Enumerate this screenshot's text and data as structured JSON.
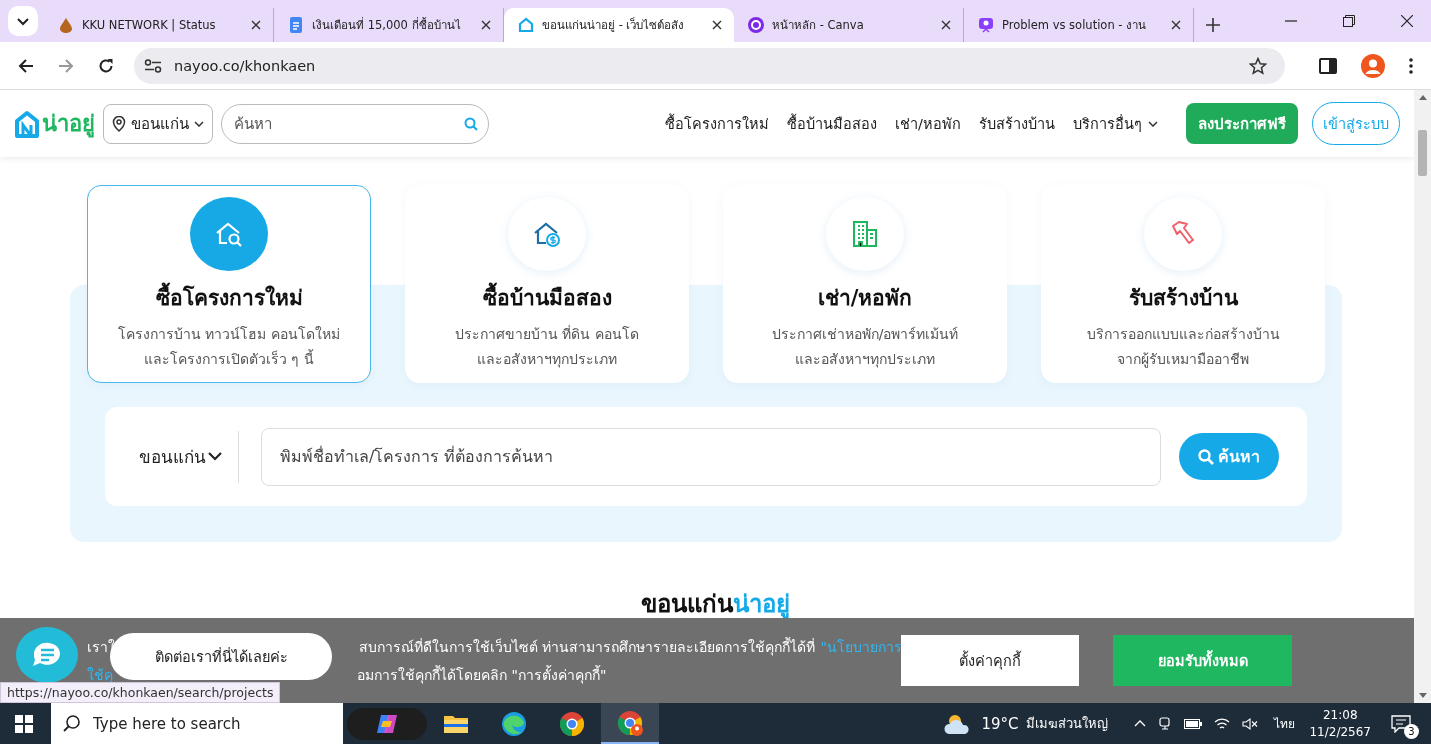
{
  "browser": {
    "tabs": [
      {
        "title": "KKU NETWORK | Status",
        "selected": false
      },
      {
        "title": "เงินเดือนที่ 15,000 กี่ซื้อบ้านไ",
        "selected": false
      },
      {
        "title": "ขอนแก่นน่าอยู่ - เว็บไซต์อสัง",
        "selected": true
      },
      {
        "title": "หน้าหลัก - Canva",
        "selected": false
      },
      {
        "title": "Problem vs solution - งาน",
        "selected": false
      }
    ],
    "address": "nayoo.co/khonkaen"
  },
  "site": {
    "logo": "น่าอยู่",
    "location": "ขอนแก่น",
    "search_placeholder": "ค้นหา",
    "nav": [
      {
        "label": "ซื้อโครงการใหม่",
        "dropdown": false
      },
      {
        "label": "ซื้อบ้านมือสอง",
        "dropdown": false
      },
      {
        "label": "เช่า/หอพัก",
        "dropdown": false
      },
      {
        "label": "รับสร้างบ้าน",
        "dropdown": false
      },
      {
        "label": "บริการอื่นๆ",
        "dropdown": true
      }
    ],
    "post_button": "ลงประกาศฟรี",
    "login_button": "เข้าสู่ระบบ"
  },
  "categories": [
    {
      "title": "ซื้อโครงการใหม่",
      "lines": [
        "โครงการบ้าน ทาวน์โฮม คอนโดใหม่",
        "และโครงการเปิดตัวเร็ว ๆ นี้"
      ],
      "selected": true
    },
    {
      "title": "ซื้อบ้านมือสอง",
      "lines": [
        "ประกาศขายบ้าน ที่ดิน คอนโด",
        "และอสังหาฯทุกประเภท"
      ],
      "selected": false
    },
    {
      "title": "เช่า/หอพัก",
      "lines": [
        "ประกาศเช่าหอพัก/อพาร์ทเม้นท์",
        "และอสังหาฯทุกประเภท"
      ],
      "selected": false
    },
    {
      "title": "รับสร้างบ้าน",
      "lines": [
        "บริการออกแบบและก่อสร้างบ้าน",
        "จากผู้รับเหมามืออาชีพ"
      ],
      "selected": false
    }
  ],
  "search": {
    "location": "ขอนแก่น",
    "placeholder": "พิมพ์ชื่อทำเล/โครงการ ที่ต้องการค้นหา",
    "button": "ค้นหา"
  },
  "heading": {
    "city": "ขอนแก่น",
    "brand": "น่าอยู่"
  },
  "cookie": {
    "line1_start": "เราใ",
    "line1_rest": "สบการณ์ที่ดีในการใช้เว็บไซต์ ท่านสามารถศึกษารายละเอียดการใช้คุกกี้ได้ที่",
    "line1_link": "\"นโยบายการ",
    "line2_link": "ใช้คุ",
    "line2_rest": "อมการใช้คุกกี้ได้โดยคลิก \"การตั้งค่าคุกกี้\"",
    "settings_button": "ตั้งค่าคุกกี้",
    "accept_button": "ยอมรับทั้งหมด"
  },
  "chat": {
    "label": "ติดต่อเราที่นี่ได้เลยค่ะ"
  },
  "status_url": "https://nayoo.co/khonkaen/search/projects",
  "taskbar": {
    "search_placeholder": "Type here to search",
    "apps": [
      {
        "selected": false
      },
      {
        "selected": false
      },
      {
        "selected": false
      },
      {
        "selected": true
      }
    ],
    "temperature": "19°C",
    "weather": "มีเมฆส่วนใหญ่",
    "language": "ไทย",
    "time": "21:08",
    "date": "11/2/2567",
    "notifications": "3"
  }
}
